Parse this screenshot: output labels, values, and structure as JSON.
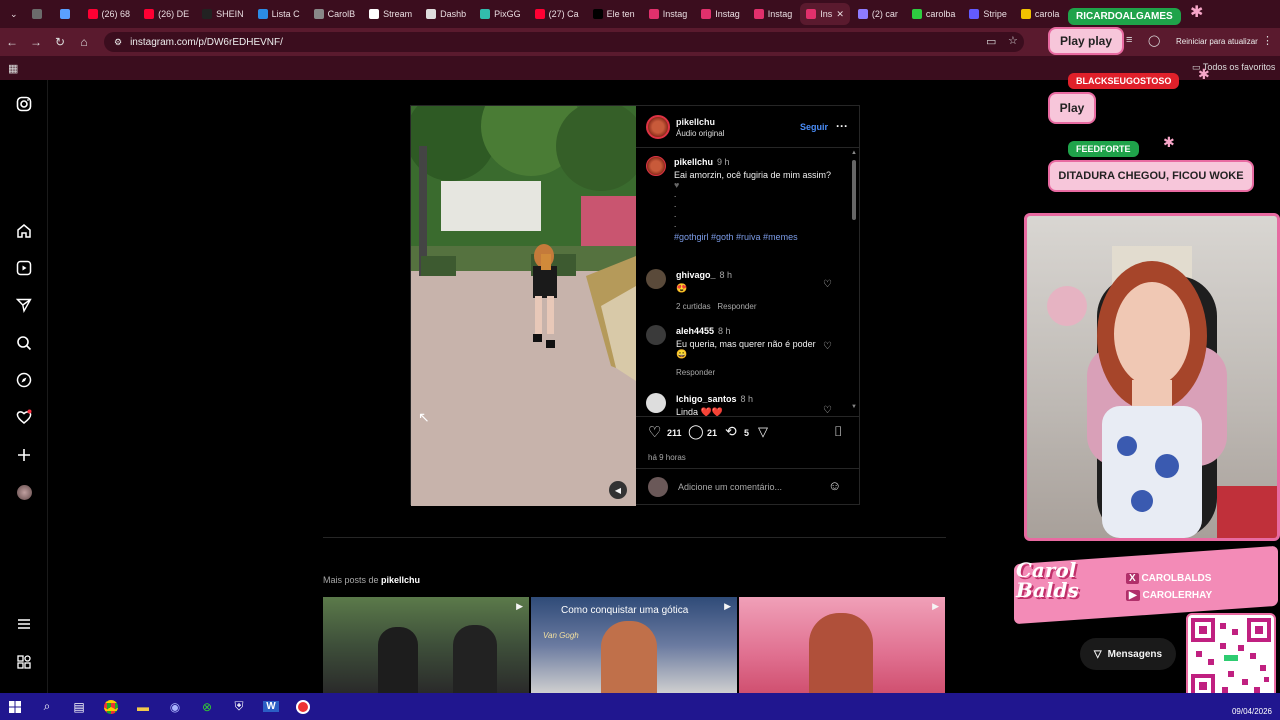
{
  "browser": {
    "tabs": [
      {
        "label": "",
        "color": "#6b6b6b"
      },
      {
        "label": "",
        "color": "#5aa0ff"
      },
      {
        "label": "(26) 68",
        "color": "#ff0033"
      },
      {
        "label": "(26) DE",
        "color": "#ff0033"
      },
      {
        "label": "SHEIN",
        "color": "#222222"
      },
      {
        "label": "Lista C",
        "color": "#2b8ce6"
      },
      {
        "label": "CarolB",
        "color": "#888888"
      },
      {
        "label": "Stream",
        "color": "#ffffff"
      },
      {
        "label": "Dashb",
        "color": "#dddddd"
      },
      {
        "label": "PixGG",
        "color": "#32bcad"
      },
      {
        "label": "(27) Ca",
        "color": "#ff0033"
      },
      {
        "label": "Ele ten",
        "color": "#000000"
      },
      {
        "label": "Instag",
        "color": "#e1306c"
      },
      {
        "label": "Instag",
        "color": "#e1306c"
      },
      {
        "label": "Instag",
        "color": "#e1306c"
      },
      {
        "label": "Ins",
        "color": "#e1306c",
        "active": true
      },
      {
        "label": "(2) car",
        "color": "#8e7cff"
      },
      {
        "label": "carolba",
        "color": "#2ecc40"
      },
      {
        "label": "Stripe",
        "color": "#635bff"
      },
      {
        "label": "carola",
        "color": "#f2c200"
      }
    ],
    "url": "instagram.com/p/DW6rEDHEVNF/",
    "restart_label": "Reiniciar para atualizar",
    "favorites_label": "Todos os favoritos"
  },
  "post": {
    "username": "pikellchu",
    "audio": "Áudio original",
    "follow": "Seguir",
    "caption_user": "pikellchu",
    "caption_time": "9 h",
    "caption_text": "Eai amorzin, ocê fugiria de mim assim?",
    "caption_dots": ".\n.\n.\n.",
    "hashtags": "#gothgirl #goth #ruiva #memes",
    "comments": [
      {
        "user": "ghivago_",
        "time": "8 h",
        "text": "😍",
        "sub1": "2 curtidas",
        "sub2": "Responder"
      },
      {
        "user": "aleh4455",
        "time": "8 h",
        "text": "Eu queria, mas querer não é poder 😀",
        "sub1": "",
        "sub2": "Responder"
      },
      {
        "user": "lchigo_santos",
        "time": "8 h",
        "text": "Linda ❤️❤️",
        "sub1": "",
        "sub2": ""
      }
    ],
    "likes": "211",
    "comment_count": "21",
    "reposts": "5",
    "posted": "há 9 horas",
    "add_comment": "Adicione um comentário..."
  },
  "more_posts": {
    "prefix": "Mais posts de",
    "user": "pikellchu",
    "thumb_caption": "Como conquistar uma gótica",
    "thumb_overlay": "Van Gogh"
  },
  "messages_label": "Mensagens",
  "overlay": {
    "play_play": "Play play",
    "play": "Play",
    "name1": "RICARDOALGAMES",
    "name2": "BLACKSEUGOSTOSO",
    "name3": "FEEDFORTE",
    "chat_msg": "DITADURA CHEGOU, FICOU WOKE",
    "logo": "Carol Balds",
    "handle_x": "CAROLBALDS",
    "handle_yt": "CAROLERHAY"
  },
  "taskbar": {
    "date": "09/04/2026"
  },
  "colors": {
    "accent_blue": "#0095f6",
    "taskbar": "#20168f",
    "overlay_pink": "#e86aa1"
  }
}
